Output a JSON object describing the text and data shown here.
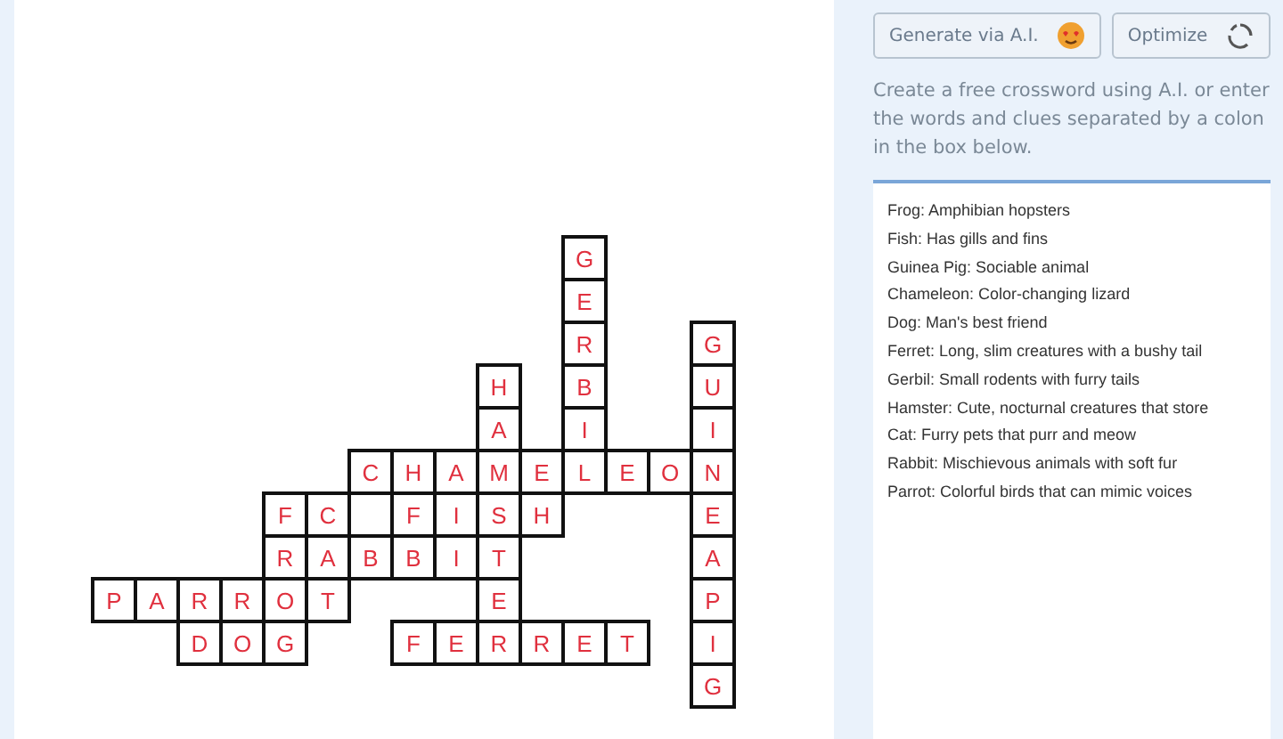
{
  "crossword": {
    "rows": [
      [
        {
          "kind": "blank"
        },
        {
          "kind": "blank"
        },
        {
          "kind": "blank"
        },
        {
          "kind": "blank"
        },
        {
          "kind": "blank"
        },
        {
          "kind": "blank"
        },
        {
          "kind": "blank"
        },
        {
          "kind": "blank"
        },
        {
          "kind": "blank"
        },
        {
          "kind": "blank"
        },
        {
          "kind": "blank"
        },
        {
          "kind": "letter",
          "letter": "G"
        },
        {
          "kind": "blank"
        },
        {
          "kind": "blank"
        },
        {
          "kind": "blank"
        }
      ],
      [
        {
          "kind": "blank"
        },
        {
          "kind": "blank"
        },
        {
          "kind": "blank"
        },
        {
          "kind": "blank"
        },
        {
          "kind": "blank"
        },
        {
          "kind": "blank"
        },
        {
          "kind": "blank"
        },
        {
          "kind": "blank"
        },
        {
          "kind": "blank"
        },
        {
          "kind": "blank"
        },
        {
          "kind": "blank"
        },
        {
          "kind": "letter",
          "letter": "E"
        },
        {
          "kind": "blank"
        },
        {
          "kind": "blank"
        },
        {
          "kind": "blank"
        }
      ],
      [
        {
          "kind": "blank"
        },
        {
          "kind": "blank"
        },
        {
          "kind": "blank"
        },
        {
          "kind": "blank"
        },
        {
          "kind": "blank"
        },
        {
          "kind": "blank"
        },
        {
          "kind": "blank"
        },
        {
          "kind": "blank"
        },
        {
          "kind": "blank"
        },
        {
          "kind": "blank"
        },
        {
          "kind": "blank"
        },
        {
          "kind": "letter",
          "letter": "R"
        },
        {
          "kind": "blank"
        },
        {
          "kind": "blank"
        },
        {
          "kind": "letter",
          "letter": "G"
        }
      ],
      [
        {
          "kind": "blank"
        },
        {
          "kind": "blank"
        },
        {
          "kind": "blank"
        },
        {
          "kind": "blank"
        },
        {
          "kind": "blank"
        },
        {
          "kind": "blank"
        },
        {
          "kind": "blank"
        },
        {
          "kind": "blank"
        },
        {
          "kind": "blank"
        },
        {
          "kind": "letter",
          "letter": "H"
        },
        {
          "kind": "blank"
        },
        {
          "kind": "letter",
          "letter": "B"
        },
        {
          "kind": "blank"
        },
        {
          "kind": "blank"
        },
        {
          "kind": "letter",
          "letter": "U"
        }
      ],
      [
        {
          "kind": "blank"
        },
        {
          "kind": "blank"
        },
        {
          "kind": "blank"
        },
        {
          "kind": "blank"
        },
        {
          "kind": "blank"
        },
        {
          "kind": "blank"
        },
        {
          "kind": "blank"
        },
        {
          "kind": "blank"
        },
        {
          "kind": "blank"
        },
        {
          "kind": "letter",
          "letter": "A"
        },
        {
          "kind": "blank"
        },
        {
          "kind": "letter",
          "letter": "I"
        },
        {
          "kind": "blank"
        },
        {
          "kind": "blank"
        },
        {
          "kind": "letter",
          "letter": "I"
        }
      ],
      [
        {
          "kind": "blank"
        },
        {
          "kind": "blank"
        },
        {
          "kind": "blank"
        },
        {
          "kind": "blank"
        },
        {
          "kind": "blank"
        },
        {
          "kind": "blank"
        },
        {
          "kind": "letter",
          "letter": "C"
        },
        {
          "kind": "letter",
          "letter": "H"
        },
        {
          "kind": "letter",
          "letter": "A"
        },
        {
          "kind": "letter",
          "letter": "M"
        },
        {
          "kind": "letter",
          "letter": "E"
        },
        {
          "kind": "letter",
          "letter": "L"
        },
        {
          "kind": "letter",
          "letter": "E"
        },
        {
          "kind": "letter",
          "letter": "O"
        },
        {
          "kind": "letter",
          "letter": "N"
        }
      ],
      [
        {
          "kind": "blank"
        },
        {
          "kind": "blank"
        },
        {
          "kind": "blank"
        },
        {
          "kind": "blank"
        },
        {
          "kind": "letter",
          "letter": "F"
        },
        {
          "kind": "letter",
          "letter": "C"
        },
        {
          "kind": "blank"
        },
        {
          "kind": "letter",
          "letter": "F"
        },
        {
          "kind": "letter",
          "letter": "I"
        },
        {
          "kind": "letter",
          "letter": "S"
        },
        {
          "kind": "letter",
          "letter": "H"
        },
        {
          "kind": "blank"
        },
        {
          "kind": "blank"
        },
        {
          "kind": "blank"
        },
        {
          "kind": "letter",
          "letter": "E"
        }
      ],
      [
        {
          "kind": "blank"
        },
        {
          "kind": "blank"
        },
        {
          "kind": "blank"
        },
        {
          "kind": "blank"
        },
        {
          "kind": "letter",
          "letter": "R"
        },
        {
          "kind": "letter",
          "letter": "A"
        },
        {
          "kind": "letter",
          "letter": "B"
        },
        {
          "kind": "letter",
          "letter": "B"
        },
        {
          "kind": "letter",
          "letter": "I"
        },
        {
          "kind": "letter",
          "letter": "T"
        },
        {
          "kind": "blank"
        },
        {
          "kind": "blank"
        },
        {
          "kind": "blank"
        },
        {
          "kind": "blank"
        },
        {
          "kind": "letter",
          "letter": "A"
        }
      ],
      [
        {
          "kind": "letter",
          "letter": "P"
        },
        {
          "kind": "letter",
          "letter": "A"
        },
        {
          "kind": "letter",
          "letter": "R"
        },
        {
          "kind": "letter",
          "letter": "R"
        },
        {
          "kind": "letter",
          "letter": "O"
        },
        {
          "kind": "letter",
          "letter": "T"
        },
        {
          "kind": "blank"
        },
        {
          "kind": "blank"
        },
        {
          "kind": "blank"
        },
        {
          "kind": "letter",
          "letter": "E"
        },
        {
          "kind": "blank"
        },
        {
          "kind": "blank"
        },
        {
          "kind": "blank"
        },
        {
          "kind": "blank"
        },
        {
          "kind": "letter",
          "letter": "P"
        }
      ],
      [
        {
          "kind": "blank"
        },
        {
          "kind": "blank"
        },
        {
          "kind": "letter",
          "letter": "D"
        },
        {
          "kind": "letter",
          "letter": "O"
        },
        {
          "kind": "letter",
          "letter": "G"
        },
        {
          "kind": "blank"
        },
        {
          "kind": "blank"
        },
        {
          "kind": "letter",
          "letter": "F"
        },
        {
          "kind": "letter",
          "letter": "E"
        },
        {
          "kind": "letter",
          "letter": "R"
        },
        {
          "kind": "letter",
          "letter": "R"
        },
        {
          "kind": "letter",
          "letter": "E"
        },
        {
          "kind": "letter",
          "letter": "T"
        },
        {
          "kind": "blank"
        },
        {
          "kind": "letter",
          "letter": "I"
        }
      ],
      [
        {
          "kind": "blank"
        },
        {
          "kind": "blank"
        },
        {
          "kind": "blank"
        },
        {
          "kind": "blank"
        },
        {
          "kind": "blank"
        },
        {
          "kind": "blank"
        },
        {
          "kind": "blank"
        },
        {
          "kind": "blank"
        },
        {
          "kind": "blank"
        },
        {
          "kind": "blank"
        },
        {
          "kind": "blank"
        },
        {
          "kind": "blank"
        },
        {
          "kind": "blank"
        },
        {
          "kind": "blank"
        },
        {
          "kind": "letter",
          "letter": "G"
        }
      ]
    ]
  },
  "buttons": [
    {
      "label": "Generate via A.I.",
      "kind": "ai"
    },
    {
      "label": "Optimize",
      "kind": "optimize"
    }
  ],
  "instructions": "Create a free crossword using A.I. or enter the words and clues separated by a colon in the box below.",
  "clues_box": {
    "lines": [
      "Frog: Amphibian hopsters",
      "Fish: Has gills and fins",
      "Guinea Pig: Sociable animal",
      "Chameleon: Color-changing lizard",
      "Dog: Man's best friend",
      "Ferret: Long, slim creatures with a bushy tail",
      "Gerbil: Small rodents with furry tails",
      "Hamster: Cute, nocturnal creatures that store",
      "Cat: Furry pets that purr and meow",
      "Rabbit: Mischievous animals with soft fur",
      "Parrot: Colorful birds that can mimic voices"
    ]
  }
}
